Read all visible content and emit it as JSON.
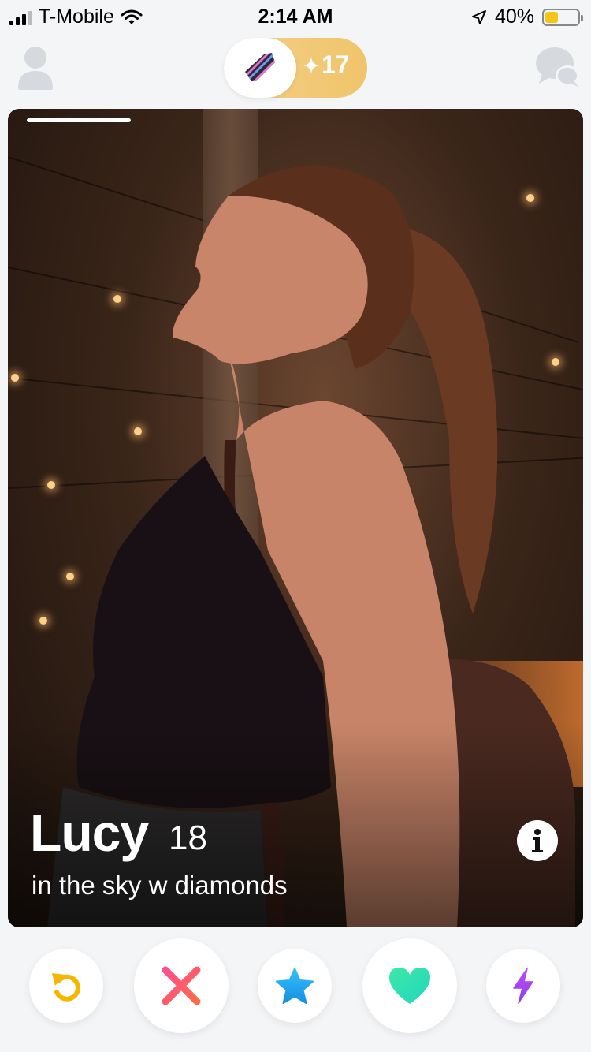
{
  "status_bar": {
    "carrier": "T-Mobile",
    "time": "2:14 AM",
    "battery_percent": "40%",
    "battery_level": 0.4,
    "icons": [
      "signal-icon",
      "wifi-icon",
      "location-arrow-icon",
      "battery-icon"
    ]
  },
  "top_nav": {
    "profile_icon": "profile-icon",
    "gold_logo_icon": "tinder-gold-logo-icon",
    "gold_count": "17",
    "gold_sparkle_icon": "sparkle-icon",
    "chat_icon": "chat-bubbles-icon"
  },
  "card": {
    "name": "Lucy",
    "age": "18",
    "bio": "in the sky w diamonds",
    "photo_index": 1,
    "info_icon": "info-icon"
  },
  "actions": [
    {
      "name": "rewind",
      "icon": "rewind-icon",
      "color": "#f5b600"
    },
    {
      "name": "nope",
      "icon": "close-icon",
      "color": "#ff5a6e"
    },
    {
      "name": "super-like",
      "icon": "star-icon",
      "color": "#1ca4f0"
    },
    {
      "name": "like",
      "icon": "heart-icon",
      "color": "#2ee0b0"
    },
    {
      "name": "boost",
      "icon": "lightning-icon",
      "color": "#a855f7"
    }
  ],
  "colors": {
    "gold_pill": "#f0c46a",
    "inactive_icon": "#d6d9de",
    "background": "#f4f5f7"
  }
}
